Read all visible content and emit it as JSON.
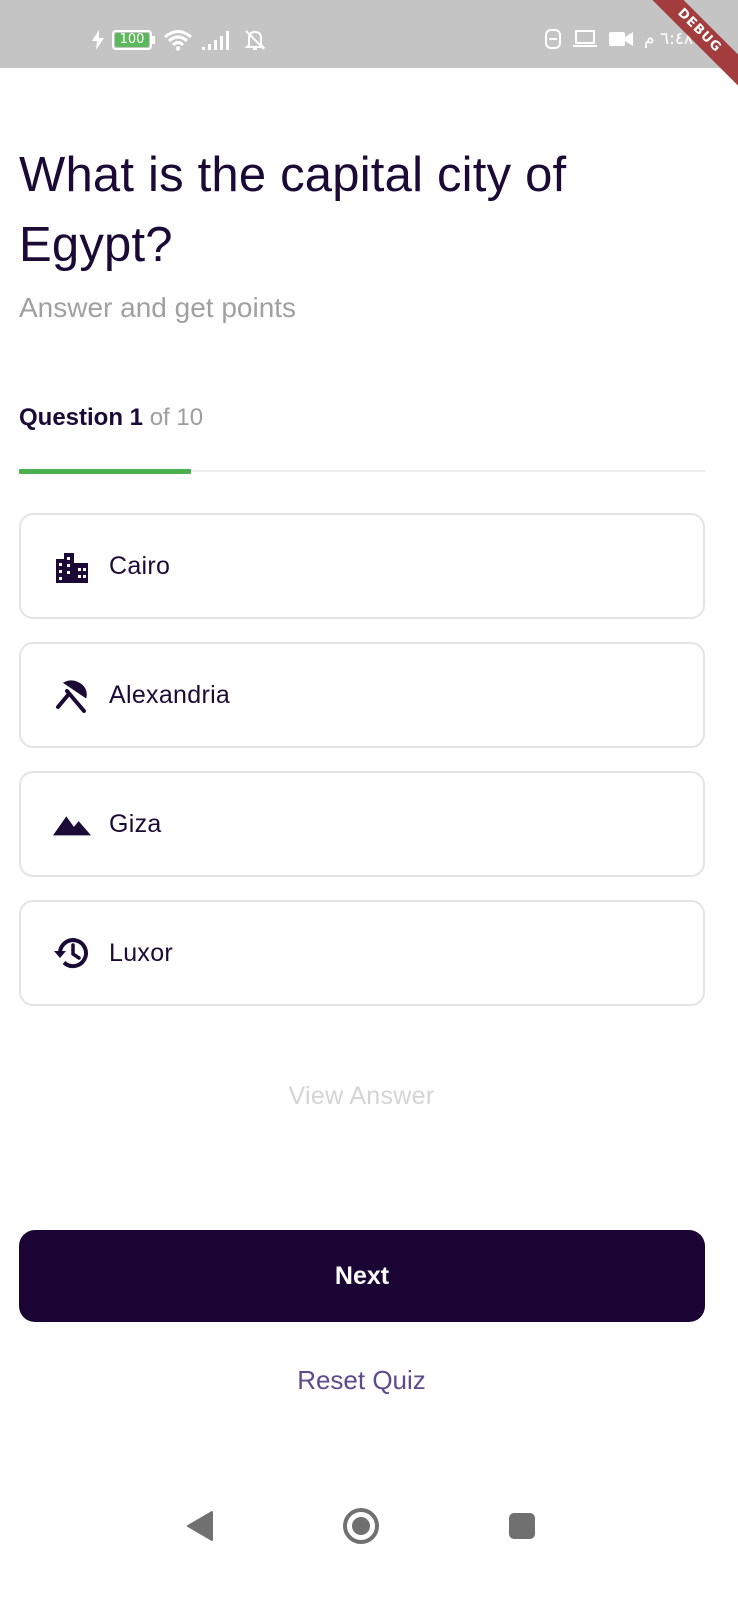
{
  "status_bar": {
    "battery": "100",
    "time": "٦:٤٨ م",
    "debug_label": "DEBUG"
  },
  "quiz": {
    "question": "What is the capital city of Egypt?",
    "subtitle": "Answer and get points",
    "counter_label": "Question 1",
    "counter_total": "of 10",
    "progress": 0.25,
    "options": [
      {
        "label": "Cairo",
        "icon": "city-icon"
      },
      {
        "label": "Alexandria",
        "icon": "beach-umbrella-icon"
      },
      {
        "label": "Giza",
        "icon": "mountains-icon"
      },
      {
        "label": "Luxor",
        "icon": "history-icon"
      }
    ],
    "view_answer": "View Answer",
    "next": "Next",
    "reset": "Reset Quiz"
  },
  "colors": {
    "primary": "#1a0535",
    "progress": "#4caf50",
    "link": "#5e4b8b",
    "muted": "#a0a0a0"
  }
}
